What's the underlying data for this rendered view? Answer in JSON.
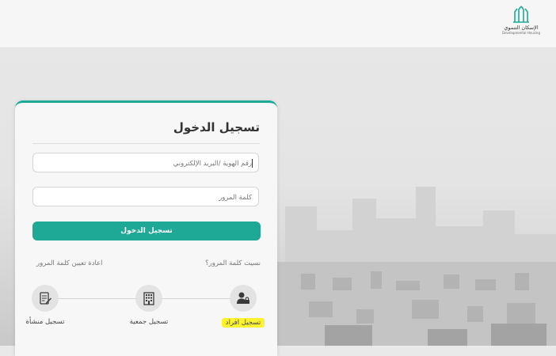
{
  "header": {
    "logo_arabic": "الإسكان التنموي",
    "logo_english": "Developmental Housing"
  },
  "login": {
    "title": "تسجيل الدخول",
    "id_placeholder": "رقم الهوية /البريد الإلكتروني",
    "password_placeholder": "كلمة المرور",
    "submit_label": "تسجيل الدخول",
    "forgot_password": "نسيت كلمة المرور؟",
    "reset_password": "اعادة تعيين كلمة المرور"
  },
  "register": {
    "individuals": "تسجيل افراد",
    "association": "تسجيل جمعية",
    "facility": "تسجيل منشأة"
  },
  "colors": {
    "accent": "#1ea996",
    "highlight": "#fbf230"
  },
  "icons": {
    "individuals": "user-lock-icon",
    "association": "building-icon",
    "facility": "document-edit-icon"
  }
}
